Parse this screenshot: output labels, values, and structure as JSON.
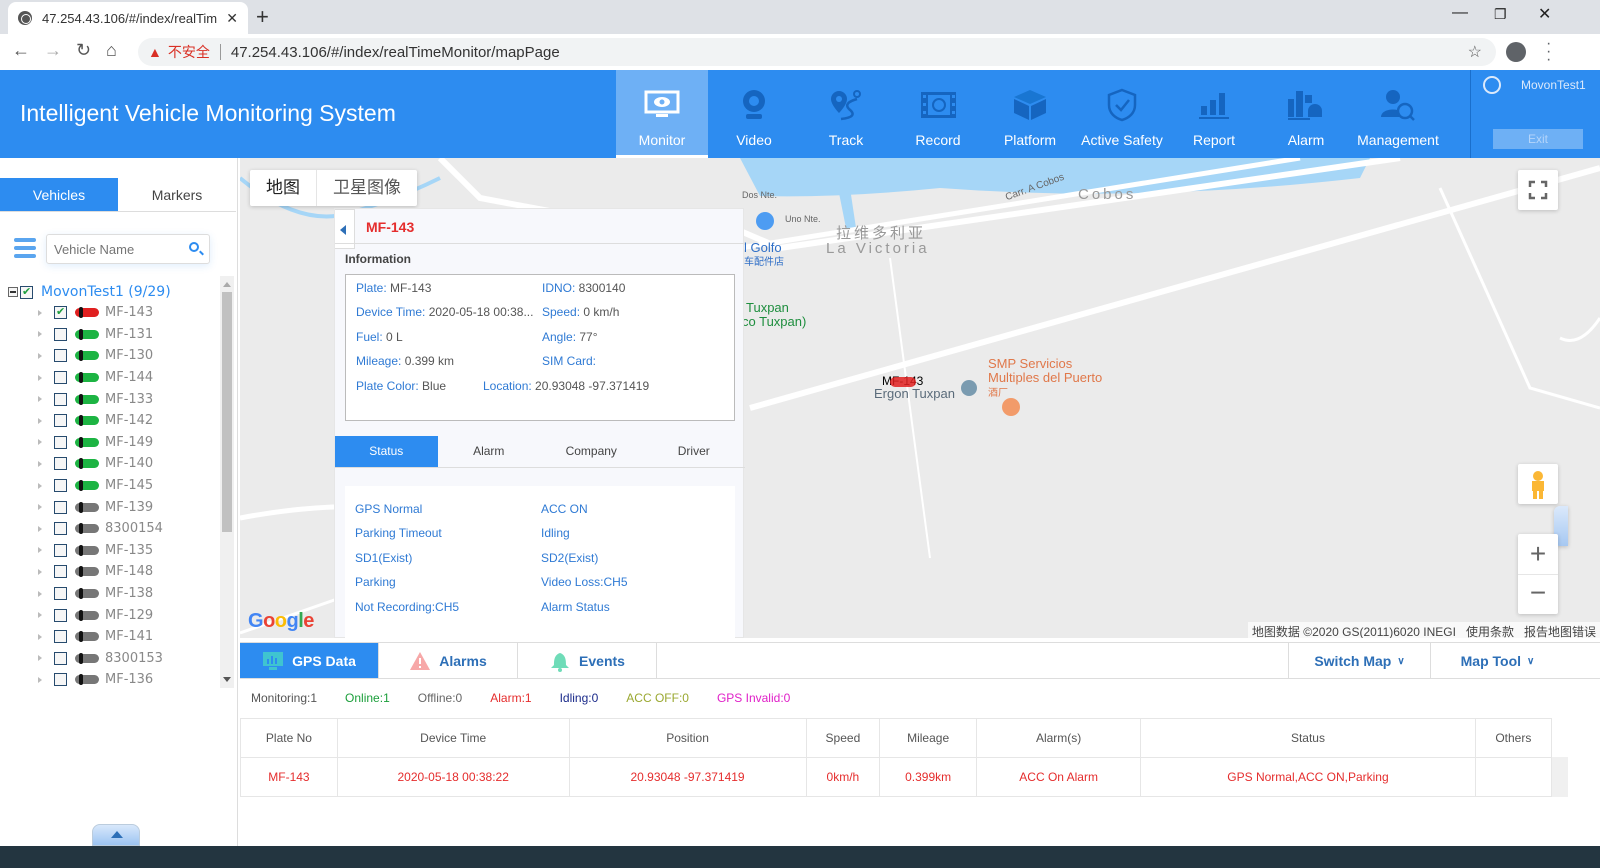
{
  "browser": {
    "tab_title": "47.254.43.106/#/index/realTim",
    "insecure_label": "不安全",
    "url": "47.254.43.106/#/index/realTimeMonitor/mapPage"
  },
  "app": {
    "title": "Intelligent Vehicle Monitoring System",
    "nav": [
      {
        "label": "Monitor",
        "icon": "monitor-eye-icon",
        "active": true
      },
      {
        "label": "Video",
        "icon": "webcam-icon"
      },
      {
        "label": "Track",
        "icon": "route-pin-icon"
      },
      {
        "label": "Record",
        "icon": "film-record-icon"
      },
      {
        "label": "Platform",
        "icon": "cube-icon"
      },
      {
        "label": "Active Safety",
        "icon": "shield-check-icon"
      },
      {
        "label": "Report",
        "icon": "bar-chart-icon"
      },
      {
        "label": "Alarm",
        "icon": "alarm-light-icon"
      },
      {
        "label": "Management",
        "icon": "user-search-icon"
      }
    ],
    "user": {
      "name": "MovonTest1",
      "exit_label": "Exit"
    }
  },
  "sidebar": {
    "tabs": [
      {
        "label": "Vehicles",
        "active": true
      },
      {
        "label": "Markers"
      }
    ],
    "search_placeholder": "Vehicle Name",
    "group": {
      "label": "MovonTest1 (9/29)",
      "checked": true
    },
    "vehicles": [
      {
        "name": "MF-143",
        "status": "red",
        "checked": true
      },
      {
        "name": "MF-131",
        "status": "green"
      },
      {
        "name": "MF-130",
        "status": "green"
      },
      {
        "name": "MF-144",
        "status": "green"
      },
      {
        "name": "MF-133",
        "status": "green"
      },
      {
        "name": "MF-142",
        "status": "green"
      },
      {
        "name": "MF-149",
        "status": "green"
      },
      {
        "name": "MF-140",
        "status": "green"
      },
      {
        "name": "MF-145",
        "status": "green"
      },
      {
        "name": "MF-139",
        "status": "gray"
      },
      {
        "name": "8300154",
        "status": "gray"
      },
      {
        "name": "MF-135",
        "status": "gray"
      },
      {
        "name": "MF-148",
        "status": "gray"
      },
      {
        "name": "MF-138",
        "status": "gray"
      },
      {
        "name": "MF-129",
        "status": "gray"
      },
      {
        "name": "MF-141",
        "status": "gray"
      },
      {
        "name": "8300153",
        "status": "gray"
      },
      {
        "name": "MF-136",
        "status": "gray"
      }
    ]
  },
  "map": {
    "type_buttons": [
      "地图",
      "卫星图像"
    ],
    "labels": {
      "dos_nte": "Dos Nte.",
      "uno_nte": "Uno Nte.",
      "carr_cobos": "Carr. A Cobos",
      "cobos": "Cobos",
      "la_victoria_cn": "拉维多利亚",
      "la_victoria": "La Victoria",
      "golfo": "l Golfo",
      "golfo_cn": "车配件店",
      "tuxpan": "Tuxpan",
      "tuxpan2": "co Tuxpan)",
      "smp1": "SMP Servicios",
      "smp2": "Multiples del Puerto",
      "smp_cn": "酒厂",
      "ergon": "Ergon Tuxpan",
      "vehicle_marker": "MF-143"
    },
    "attribution": [
      "地图数据 ©2020 GS(2011)6020 INEGI",
      "使用条款",
      "报告地图错误"
    ],
    "google": "Google"
  },
  "popup": {
    "title": "MF-143",
    "section": "Information",
    "info": {
      "plate": {
        "k": "Plate:",
        "v": " MF-143"
      },
      "idno": {
        "k": "IDNO:",
        "v": " 8300140"
      },
      "device_time": {
        "k": "Device Time:",
        "v": " 2020-05-18 00:38..."
      },
      "speed": {
        "k": "Speed:",
        "v": " 0 km/h"
      },
      "fuel": {
        "k": "Fuel:",
        "v": " 0 L"
      },
      "angle": {
        "k": "Angle:",
        "v": " 77°"
      },
      "mileage": {
        "k": "Mileage:",
        "v": " 0.399 km"
      },
      "sim": {
        "k": "SIM Card:",
        "v": ""
      },
      "plate_color": {
        "k": "Plate Color:",
        "v": " Blue"
      },
      "location": {
        "k": "Location:",
        "v": " 20.93048 -97.371419"
      }
    },
    "tabs": [
      "Status",
      "Alarm",
      "Company",
      "Driver"
    ],
    "status": [
      "GPS Normal",
      "ACC ON",
      "Parking Timeout",
      "Idling",
      "SD1(Exist)",
      "SD2(Exist)",
      "Parking",
      "Video Loss:CH5",
      "Not Recording:CH5",
      "Alarm Status"
    ]
  },
  "bottom": {
    "tabs": [
      "GPS Data",
      "Alarms",
      "Events"
    ],
    "switch_map": "Switch Map",
    "map_tool": "Map Tool",
    "counts": [
      {
        "label": "Monitoring:1",
        "color": "#555555"
      },
      {
        "label": "Online:1",
        "color": "#1a9e3a"
      },
      {
        "label": "Offline:0",
        "color": "#666666"
      },
      {
        "label": "Alarm:1",
        "color": "#e52d2d"
      },
      {
        "label": "Idling:0",
        "color": "#1a2a8a"
      },
      {
        "label": "ACC OFF:0",
        "color": "#9aa830"
      },
      {
        "label": "GPS Invalid:0",
        "color": "#e020c8"
      }
    ],
    "columns": [
      "Plate No",
      "Device Time",
      "Position",
      "Speed",
      "Mileage",
      "Alarm(s)",
      "Status",
      "Others"
    ],
    "rows": [
      [
        "MF-143",
        "2020-05-18 00:38:22",
        "20.93048 -97.371419",
        "0km/h",
        "0.399km",
        "ACC On Alarm",
        "GPS Normal,ACC ON,Parking",
        ""
      ]
    ]
  }
}
